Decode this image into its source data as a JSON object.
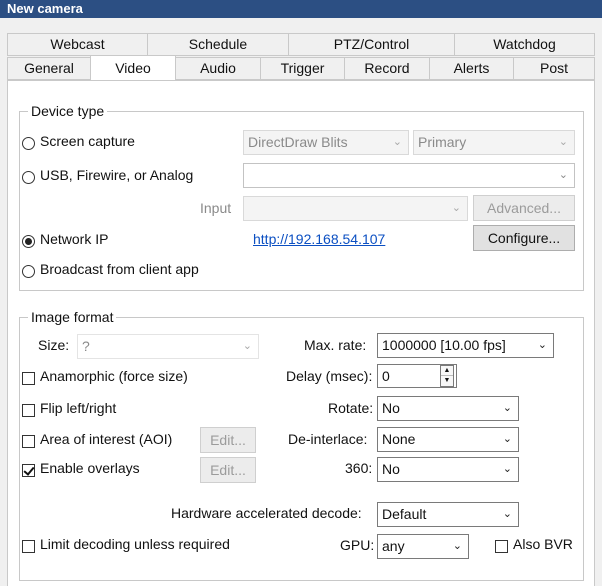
{
  "window": {
    "title": "New camera"
  },
  "tabs_top": [
    "Webcast",
    "Schedule",
    "PTZ/Control",
    "Watchdog"
  ],
  "tabs_bottom": [
    "General",
    "Video",
    "Audio",
    "Trigger",
    "Record",
    "Alerts",
    "Post"
  ],
  "device_type": {
    "legend": "Device type",
    "screen_capture": {
      "label": "Screen capture",
      "combo1": "DirectDraw Blits",
      "combo2": "Primary"
    },
    "usb": {
      "label": "USB, Firewire, or Analog",
      "combo": ""
    },
    "input": {
      "label": "Input",
      "combo": "",
      "advanced_button": "Advanced..."
    },
    "network_ip": {
      "label": "Network IP",
      "url": "http://192.168.54.107",
      "configure_button": "Configure..."
    },
    "broadcast": {
      "label": "Broadcast from client app"
    }
  },
  "image_format": {
    "legend": "Image format",
    "size": {
      "label": "Size:",
      "value": "?"
    },
    "anamorphic": {
      "label": "Anamorphic (force size)"
    },
    "flip": {
      "label": "Flip left/right"
    },
    "aoi": {
      "label": "Area of interest (AOI)",
      "edit_button": "Edit..."
    },
    "overlays": {
      "label": "Enable overlays",
      "edit_button": "Edit..."
    },
    "max_rate": {
      "label": "Max. rate:",
      "value": "1000000 [10.00 fps]"
    },
    "delay": {
      "label": "Delay (msec):",
      "value": "0"
    },
    "rotate": {
      "label": "Rotate:",
      "value": "No"
    },
    "deinterlace": {
      "label": "De-interlace:",
      "value": "None"
    },
    "three_sixty": {
      "label": "360:",
      "value": "No"
    },
    "hw_decode": {
      "label": "Hardware accelerated decode:",
      "value": "Default"
    },
    "limit_decoding": {
      "label": "Limit decoding unless required"
    },
    "gpu": {
      "label": "GPU:",
      "value": "any"
    },
    "also_bvr": {
      "label": "Also BVR"
    }
  },
  "icons": {
    "dropdown": "chevron-down-icon",
    "spin_up": "▲",
    "spin_down": "▼"
  },
  "colors": {
    "titlebar": "#2c4f83",
    "link": "#0b4fc2"
  }
}
